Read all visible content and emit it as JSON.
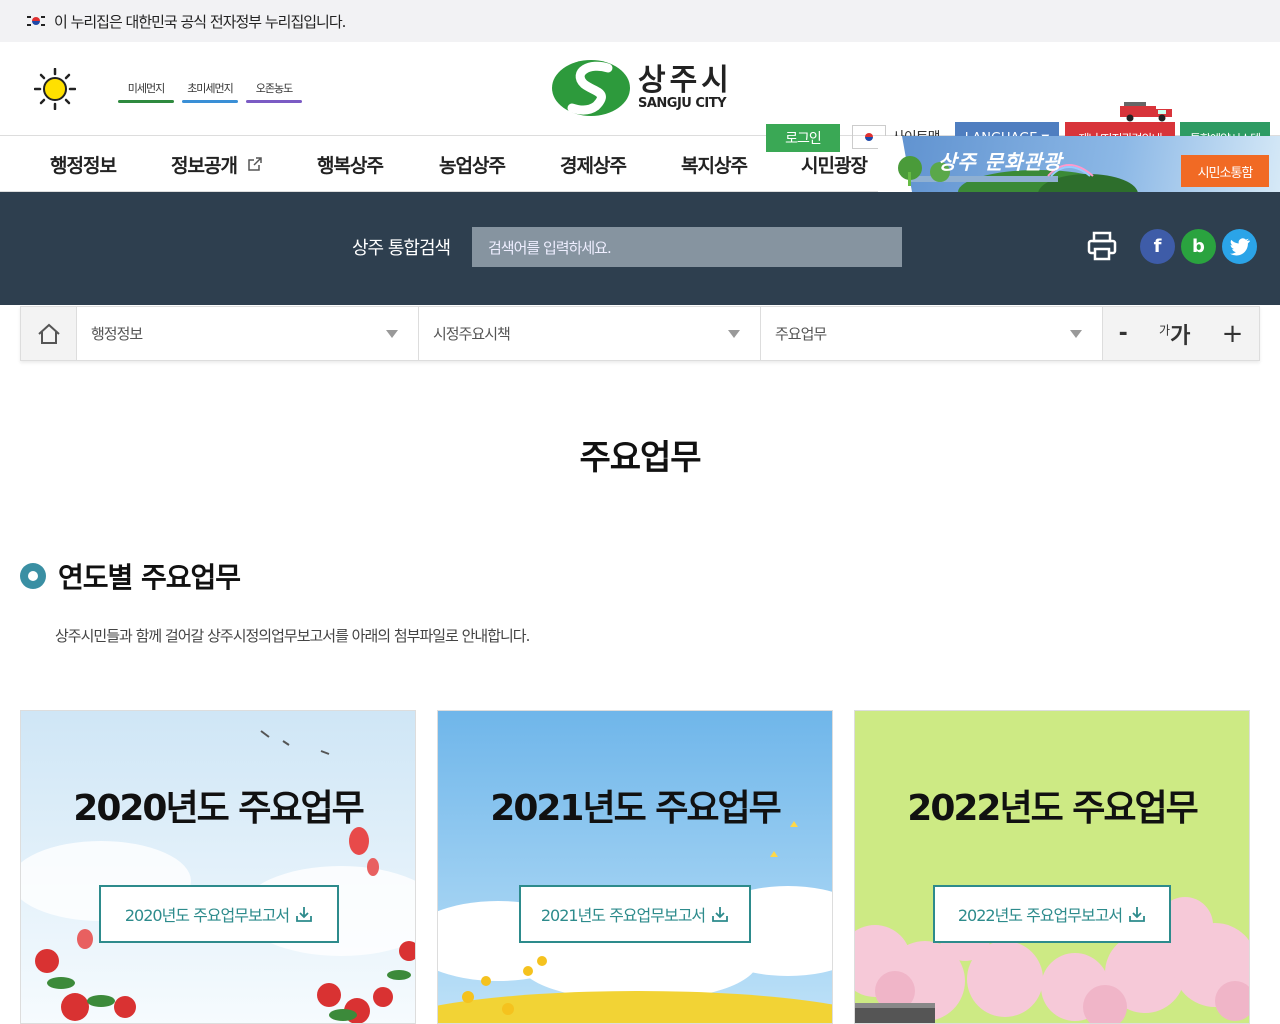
{
  "gov_banner": {
    "text": "이 누리집은 대한민국 공식 전자정부 누리집입니다."
  },
  "air": [
    {
      "label": "미세먼지",
      "color": "#2f8a3f"
    },
    {
      "label": "초미세먼지",
      "color": "#3a8fd6"
    },
    {
      "label": "오존농도",
      "color": "#7b5bc4"
    }
  ],
  "logo": {
    "ko": "상주시",
    "en": "SANGJU CITY"
  },
  "header": {
    "login": "로그인",
    "sitemap": "사이트맵",
    "language": "LANGUAGE",
    "disaster": "재난/지진관련안내",
    "reserve": "통합예약시스템"
  },
  "gnb": [
    "행정정보",
    "정보공개",
    "행복상주",
    "농업상주",
    "경제상주",
    "복지상주",
    "시민광장"
  ],
  "tour": {
    "text": "상주 문화관광",
    "civil_button": "시민소통함"
  },
  "search": {
    "label": "상주 통합검색",
    "placeholder": "검색어를 입력하세요."
  },
  "location": {
    "level1": "행정정보",
    "level2": "시정주요시책",
    "level3": "주요업무",
    "font_minus": "-",
    "font_plus": "+",
    "font_small": "가",
    "font_large": "가"
  },
  "page": {
    "title": "주요업무",
    "section_title": "연도별 주요업무",
    "description": "상주시민들과 함께 걸어갈 상주시정의업무보고서를 아래의 첨부파일로 안내합니다."
  },
  "cards": [
    {
      "title": "2020년도 주요업무",
      "button": "2020년도 주요업무보고서"
    },
    {
      "title": "2021년도 주요업무",
      "button": "2021년도 주요업무보고서"
    },
    {
      "title": "2022년도 주요업무",
      "button": "2022년도 주요업무보고서"
    }
  ],
  "colors": {
    "accent": "#2d8b8c",
    "search_band": "#2e3f4f",
    "login": "#3aa855",
    "disaster": "#d8343a"
  }
}
